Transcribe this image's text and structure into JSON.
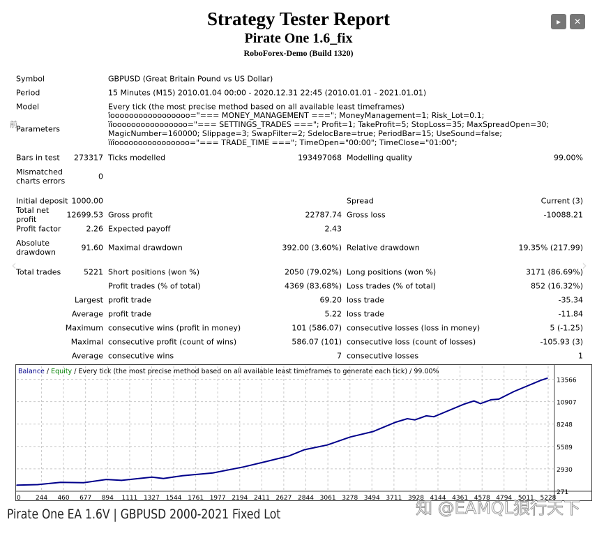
{
  "header": {
    "title": "Strategy Tester Report",
    "subtitle": "Pirate One 1.6_fix",
    "server": "RoboForex-Demo (Build 1320)"
  },
  "controls": {
    "next_icon": "play-icon",
    "next_glyph": "▸",
    "close_icon": "close-icon",
    "close_glyph": "✕",
    "prev_arrow": "‹",
    "next_arrow": "›"
  },
  "info_rows": [
    {
      "label": "Symbol",
      "value": "GBPUSD (Great Britain Pound vs US Dollar)"
    },
    {
      "label": "Period",
      "value": "15 Minutes (M15) 2010.01.04 00:00 - 2020.12.31 22:45 (2010.01.01 - 2021.01.01)"
    },
    {
      "label": "Model",
      "value": "Every tick (the most precise method based on all available least timeframes)"
    },
    {
      "label": "Parameters",
      "value": "îooooooooooooooooo=\"=== MONEY_MANAGEMENT ===\"; MoneyManagement=1; Risk_Lot=0.1; ïîoooooooooooooooo=\"=== SETTINGS_TRADES ===\"; Profit=1; TakeProfit=5; StopLoss=35; MaxSpreadOpen=30; MagicNumber=160000; Slippage=3; SwapFilter=2; SdelocBare=true; PeriodBar=15; UseSound=false; ïïîoooooooooooooooo=\"=== TRADE_TIME ===\"; TimeOpen=\"00:00\"; TimeClose=\"01:00\";"
    }
  ],
  "params_icon": "前",
  "stats_rows": [
    [
      "Bars in test",
      "273317",
      "Ticks modelled",
      "193497068",
      "Modelling quality",
      "99.00%"
    ],
    [
      "Mismatched charts errors",
      "0",
      "",
      "",
      "",
      ""
    ],
    [
      "Initial deposit",
      "1000.00",
      "",
      "",
      "Spread",
      "Current (3)"
    ],
    [
      "Total net profit",
      "12699.53",
      "Gross profit",
      "22787.74",
      "Gross loss",
      "-10088.21"
    ],
    [
      "Profit factor",
      "2.26",
      "Expected payoff",
      "2.43",
      "",
      ""
    ],
    [
      "Absolute drawdown",
      "91.60",
      "Maximal drawdown",
      "392.00 (3.60%)",
      "Relative drawdown",
      "19.35% (217.99)"
    ],
    [
      "Total trades",
      "5221",
      "Short positions (won %)",
      "2050 (79.02%)",
      "Long positions (won %)",
      "3171 (86.69%)"
    ],
    [
      "",
      "",
      "Profit trades (% of total)",
      "4369 (83.68%)",
      "Loss trades (% of total)",
      "852 (16.32%)"
    ],
    [
      "",
      "Largest",
      "profit trade",
      "69.20",
      "loss trade",
      "-35.34"
    ],
    [
      "",
      "Average",
      "profit trade",
      "5.22",
      "loss trade",
      "-11.84"
    ],
    [
      "",
      "Maximum",
      "consecutive wins (profit in money)",
      "101 (586.07)",
      "consecutive losses (loss in money)",
      "5 (-1.25)"
    ],
    [
      "",
      "Maximal",
      "consecutive profit (count of wins)",
      "586.07 (101)",
      "consecutive loss (count of losses)",
      "-105.93 (3)"
    ],
    [
      "",
      "Average",
      "consecutive wins",
      "7",
      "consecutive losses",
      "1"
    ]
  ],
  "chart_legend": {
    "balance": "Balance",
    "sep1": " / ",
    "equity": "Equity",
    "rest": " / Every tick (the most precise method based on all available least timeframes to generate each tick) / 99.00%"
  },
  "chart_data": {
    "type": "line",
    "title": "",
    "xlabel": "",
    "ylabel": "",
    "x_ticks": [
      "0",
      "244",
      "460",
      "677",
      "894",
      "1111",
      "1327",
      "1544",
      "1761",
      "1977",
      "2194",
      "2411",
      "2627",
      "2844",
      "3061",
      "3278",
      "3494",
      "3711",
      "3928",
      "4144",
      "4361",
      "4578",
      "4794",
      "5011",
      "5228"
    ],
    "y_ticks": [
      "271",
      "2930",
      "5589",
      "8248",
      "10907",
      "13566"
    ],
    "xlim": [
      0,
      5290
    ],
    "ylim": [
      271,
      15100
    ],
    "grid": true,
    "colors": {
      "balance": "#00008b",
      "equity": "#008000",
      "grid": "#c8c8c8"
    },
    "series": [
      {
        "name": "Balance",
        "x": [
          0,
          206,
          431,
          656,
          881,
          1031,
          1331,
          1443,
          1630,
          1930,
          2230,
          2455,
          2680,
          2830,
          3055,
          3280,
          3504,
          3729,
          3842,
          3917,
          4029,
          4104,
          4404,
          4498,
          4561,
          4666,
          4741,
          4891,
          5153,
          5221
        ],
        "y": [
          1000,
          1055,
          1335,
          1280,
          1670,
          1560,
          1950,
          1780,
          2120,
          2450,
          3150,
          3800,
          4470,
          5200,
          5760,
          6710,
          7350,
          8470,
          8890,
          8750,
          9230,
          9120,
          10630,
          10990,
          10680,
          11130,
          11210,
          12110,
          13430,
          13700
        ]
      }
    ]
  },
  "caption": "Pirate One EA 1.6V | GBPUSD 2000-2021 Fixed Lot",
  "watermark": "知 @EAMQL狼行天下"
}
